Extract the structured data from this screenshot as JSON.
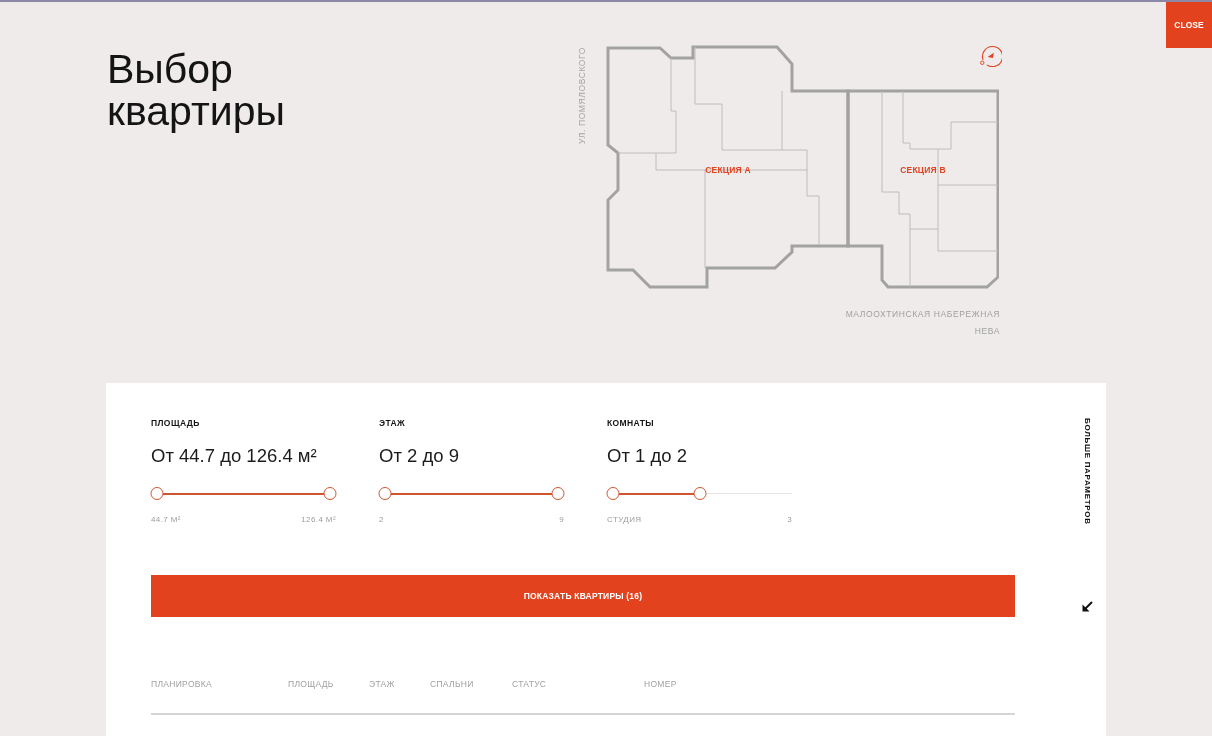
{
  "close_button": {
    "label": "CLOSE"
  },
  "title": "Выбор квартиры",
  "site_plan": {
    "street_label": "УЛ. ПОМЯЛОВСКОГО",
    "sections": [
      {
        "label": "СЕКЦИЯ А"
      },
      {
        "label": "СЕКЦИЯ В"
      }
    ],
    "embankment_label": "МАЛООХТИНСКАЯ НАБЕРЕЖНАЯ",
    "river_label": "НЕВА"
  },
  "filters": [
    {
      "label": "ПЛОЩАДЬ",
      "value": "От 44.7 до 126.4 м²",
      "handles": [
        {
          "level": 0
        },
        {
          "level": 1
        }
      ],
      "min_label": "44.7 М²",
      "max_label": "126.4 М²"
    },
    {
      "label": "ЭТАЖ",
      "value": "От 2 до 9",
      "handles": [
        {
          "level": 0
        },
        {
          "level": 1
        }
      ],
      "min_label": "2",
      "max_label": "9"
    },
    {
      "label": "КОМНАТЫ",
      "value": "От 1 до 2",
      "handles": [
        {
          "level": 0
        },
        {
          "level": 0.5
        }
      ],
      "min_label": "СТУДИЯ",
      "max_label": "3"
    }
  ],
  "more_parameters": {
    "label": "БОЛЬШЕ ПАРАМЕТРОВ"
  },
  "show_button": {
    "label": "ПОКАЗАТЬ КВАРТИРЫ (16)"
  },
  "table": {
    "columns": [
      "ПЛАНИРОВКА",
      "ПЛОЩАДЬ",
      "ЭТАЖ",
      "СПАЛЬНИ",
      "СТАТУС",
      "НОМЕР"
    ]
  }
}
